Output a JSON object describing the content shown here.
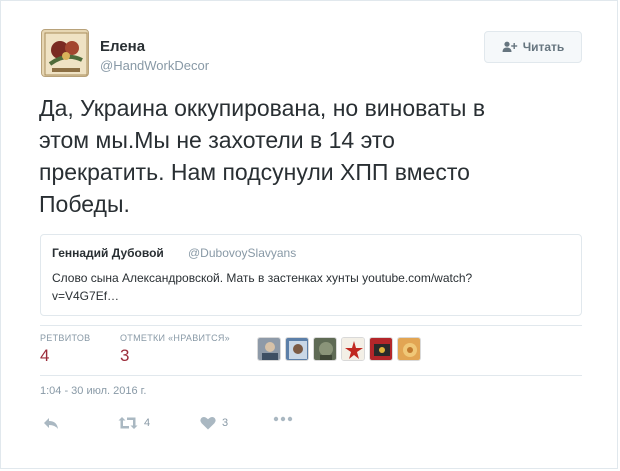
{
  "author": {
    "name": "Елена",
    "handle": "@HandWorkDecor"
  },
  "follow_button": {
    "label": "Читать",
    "icon": "add-user-icon"
  },
  "tweet": {
    "text": "Да, Украина оккупирована, но виноваты в\nэтом мы.Мы не захотели в 14 это\nпрекратить. Нам подсунули ХПП вместо\nПобеды."
  },
  "quoted_tweet": {
    "name": "Геннадий Дубовой",
    "handle": "@DubovoySlavyans",
    "text": "Слово сына Александровской. Мать в застенках хунты youtube.com/watch?\nv=V4G7Ef…"
  },
  "stats": {
    "retweets_label": "РЕТВИТОВ",
    "retweets_value": "4",
    "likes_label": "ОТМЕТКИ «НРАВИТСЯ»",
    "likes_value": "3"
  },
  "timestamp": "1:04 - 30 июл. 2016 г.",
  "actions": {
    "reply_icon": "reply-icon",
    "retweet_icon": "retweet-icon",
    "retweet_count": "4",
    "like_icon": "heart-icon",
    "like_count": "3",
    "more_icon": "more-dots-icon"
  },
  "colors": {
    "text": "#292f33",
    "muted": "#8899a6",
    "border": "#e1e8ed",
    "stat_value": "#9b2b3a"
  }
}
